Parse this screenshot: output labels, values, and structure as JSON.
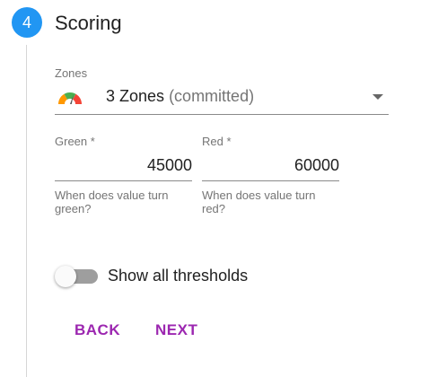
{
  "step": {
    "number": "4",
    "title": "Scoring"
  },
  "zones": {
    "label": "Zones",
    "icon": "gauge-icon",
    "value": "3 Zones",
    "note": "(committed)"
  },
  "green": {
    "label": "Green *",
    "value": "45000",
    "help": "When does value turn green?"
  },
  "red": {
    "label": "Red *",
    "value": "60000",
    "help": "When does value turn red?"
  },
  "thresholds_toggle": {
    "label": "Show all thresholds",
    "on": false
  },
  "actions": {
    "back_label": "BACK",
    "next_label": "NEXT"
  },
  "colors": {
    "step_accent": "#2196f3",
    "button_text": "#9c27b0",
    "gauge_red": "#f44336",
    "gauge_orange": "#ff9800",
    "gauge_green": "#4caf50"
  }
}
